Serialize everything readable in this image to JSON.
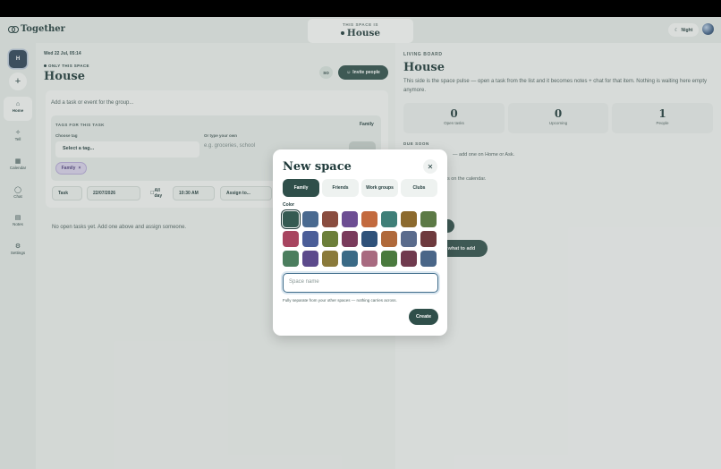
{
  "app": {
    "name": "Together"
  },
  "header": {
    "space_caption": "THIS SPACE IS",
    "space_name": "House",
    "night_label": "Night"
  },
  "sidebar": {
    "workspace_initial": "H",
    "items": [
      {
        "label": "Home",
        "icon": "home-icon"
      },
      {
        "label": "Tell",
        "icon": "sparkle-icon"
      },
      {
        "label": "Calendar",
        "icon": "calendar-icon"
      },
      {
        "label": "Chat",
        "icon": "chat-icon"
      },
      {
        "label": "Notes",
        "icon": "notes-icon"
      },
      {
        "label": "Settings",
        "icon": "gear-icon"
      }
    ]
  },
  "left": {
    "date": "Wed 22 Jul, 05:14",
    "only_this_space": "ONLY THIS SPACE",
    "title": "House",
    "so_chip": "SO",
    "invite_label": "Invite people",
    "task_placeholder": "Add a task or event for the group...",
    "tags_label": "TAGS FOR THIS TASK",
    "tags_family": "Family",
    "choose_tag_label": "Choose tag",
    "select_tag_value": "Select a tag...",
    "own_tag_label": "Or type your own",
    "own_tag_placeholder": "e.g. groceries, school",
    "family_chip": "Family",
    "type_value": "Task",
    "date_value": "22/07/2026",
    "allday_label": "All day",
    "time_value": "10:30 AM",
    "assign_label": "Assign to...",
    "no_tasks": "No open tasks yet. Add one above and assign someone."
  },
  "right": {
    "caption": "LIVING BOARD",
    "title": "House",
    "description": "This side is the space pulse — open a task from the list and it becomes notes + chat for that item. Nothing is waiting here empty anymore.",
    "stats": [
      {
        "value": "0",
        "label": "Open tasks"
      },
      {
        "value": "0",
        "label": "Upcoming"
      },
      {
        "value": "1",
        "label": "People"
      }
    ],
    "due_caption": "DUE SOON",
    "due_text_1": "— add one on Home or Ask.",
    "due_text_2": "s on the calendar.",
    "pill_text": "r what to add"
  },
  "modal": {
    "title": "New space",
    "close_icon": "close-icon",
    "tabs": [
      "Family",
      "Friends",
      "Work groups",
      "Clubs"
    ],
    "active_tab": "Family",
    "color_label": "Color",
    "colors": [
      "#355a52",
      "#4a6a90",
      "#8a4d3f",
      "#6d4e93",
      "#c36a3e",
      "#3f7f78",
      "#8c6a2e",
      "#5c7a46",
      "#a84560",
      "#4b5e98",
      "#6c7f3a",
      "#7a3b5c",
      "#2f527a",
      "#b0693a",
      "#5a6b8c",
      "#6e3a3e",
      "#4b7e5e",
      "#5c4a8c",
      "#8a7a3a",
      "#3a6a86",
      "#a86a80",
      "#4a7a3e",
      "#703a4e",
      "#4a6688"
    ],
    "selected_color": "#355a52",
    "input_placeholder": "Space name",
    "note": "Fully separate from your other spaces — nothing carries across.",
    "create_label": "Create"
  }
}
